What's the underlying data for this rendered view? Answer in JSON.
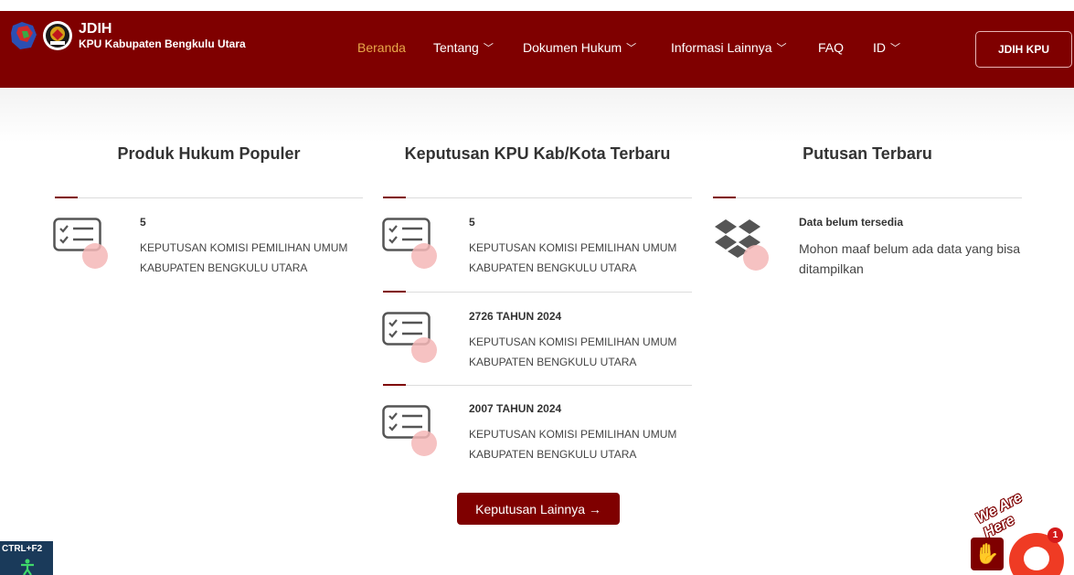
{
  "header": {
    "title": "JDIH",
    "subtitle": "KPU Kabupaten Bengkulu Utara",
    "nav": [
      {
        "label": "Beranda",
        "active": true,
        "dropdown": false
      },
      {
        "label": "Tentang",
        "active": false,
        "dropdown": true
      },
      {
        "label": "Dokumen Hukum",
        "active": false,
        "dropdown": true
      },
      {
        "label": "Informasi Lainnya",
        "active": false,
        "dropdown": true
      },
      {
        "label": "FAQ",
        "active": false,
        "dropdown": false
      },
      {
        "label": "ID",
        "active": false,
        "dropdown": true
      }
    ],
    "cta_label": "JDIH KPU"
  },
  "columns": {
    "populer": {
      "title": "Produk Hukum Populer",
      "items": [
        {
          "number": "5",
          "desc": "KEPUTUSAN KOMISI PEMILIHAN UMUM KABUPATEN BENGKULU UTARA"
        }
      ]
    },
    "keputusan": {
      "title": "Keputusan KPU Kab/Kota Terbaru",
      "items": [
        {
          "number": "5",
          "desc": "KEPUTUSAN KOMISI PEMILIHAN UMUM KABUPATEN BENGKULU UTARA"
        },
        {
          "number": "2726 TAHUN 2024",
          "desc": "KEPUTUSAN KOMISI PEMILIHAN UMUM KABUPATEN BENGKULU UTARA"
        },
        {
          "number": "2007 TAHUN 2024",
          "desc": "KEPUTUSAN KOMISI PEMILIHAN UMUM KABUPATEN BENGKULU UTARA"
        }
      ],
      "more_label": "Keputusan Lainnya →"
    },
    "putusan": {
      "title": "Putusan Terbaru",
      "empty_title": "Data belum tersedia",
      "empty_desc": "Mohon maaf belum ada data yang bisa ditampilkan"
    }
  },
  "widgets": {
    "shortcut_label": "CTRL+F2",
    "chat_tagline": "We Are Here",
    "chat_badge": "1"
  },
  "colors": {
    "primary": "#7f0000",
    "nav_active": "#e8a84a",
    "icon_accent": "#f4b7b7"
  },
  "icons": {
    "checklist": "checklist-icon",
    "dropbox": "dropbox-icon",
    "chevron": "chevron-down-icon",
    "chat": "chat-icon",
    "wave": "wave-icon",
    "accessibility": "accessibility-icon"
  }
}
